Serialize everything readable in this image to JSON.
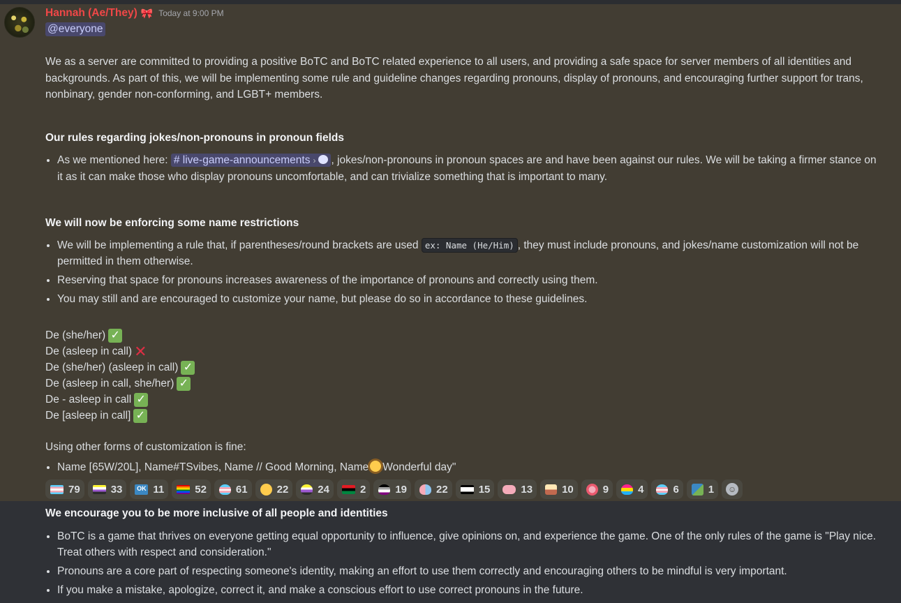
{
  "message": {
    "username": "Hannah (Ae/They)",
    "role_icon": "🎀",
    "timestamp": "Today at 9:00 PM",
    "mention": "@everyone",
    "intro": "We as a server are committed to providing a positive BoTC and BoTC related experience to all users, and providing a safe space for server members of all identities and backgrounds. As part of this, we will be implementing some rule and guideline changes regarding pronouns, display of pronouns, and encouraging further support for trans, nonbinary, gender non-conforming, and LGBT+ members.",
    "section1": {
      "heading": "Our rules regarding jokes/non-pronouns in pronoun fields",
      "bullet_prefix": "As we mentioned here:",
      "channel": "live-game-announcements",
      "bullet_suffix": ", jokes/non-pronouns in pronoun spaces are and have been against our rules. We will be taking a firmer stance on it as it can make those who display pronouns uncomfortable, and can trivialize something that is important to many."
    },
    "section2": {
      "heading": "We will now be enforcing some name restrictions",
      "b1_prefix": "We will be implementing a rule that, if parentheses/round brackets are used ",
      "b1_code": "ex: Name (He/Him)",
      "b1_suffix": ", they must include pronouns, and jokes/name customization will not be permitted in them otherwise.",
      "b2": "Reserving that space for pronouns increases awareness of the importance of pronouns and correctly using them.",
      "b3": "You may still and are encouraged to customize your name, but please do so in accordance to these guidelines."
    },
    "examples": [
      {
        "text": "De (she/her)",
        "ok": "✓"
      },
      {
        "text": "De (asleep in call)",
        "bad": "✕"
      },
      {
        "text": "De (she/her) (asleep in call)",
        "ok": "✓"
      },
      {
        "text": "De (asleep in call, she/her)",
        "ok": "✓"
      },
      {
        "text": "De - asleep in call",
        "ok": "✓"
      },
      {
        "text": "De [asleep in call]",
        "ok": "✓"
      }
    ],
    "customization": {
      "intro": "Using other forms of customization is fine:",
      "bullet_a": "Name [65W/20L], Name#TSvibes, Name // Good Morning, Name",
      "bullet_b": "Wonderful day\""
    },
    "reactions": [
      {
        "icon": "trans-flag-icon",
        "count": "79"
      },
      {
        "icon": "nonbinary-flag-icon",
        "count": "33"
      },
      {
        "icon": "ok-icon",
        "count": "11"
      },
      {
        "icon": "rainbow-flag-icon",
        "count": "52"
      },
      {
        "icon": "trans-heart-icon",
        "count": "61"
      },
      {
        "icon": "face-icon",
        "count": "22"
      },
      {
        "icon": "nonbinary-heart-icon",
        "count": "24"
      },
      {
        "icon": "pan-african-flag-icon",
        "count": "2"
      },
      {
        "icon": "ace-flag-icon",
        "count": "19"
      },
      {
        "icon": "genderfluid-heart-icon",
        "count": "22"
      },
      {
        "icon": "ace-stripe-flag-icon",
        "count": "15"
      },
      {
        "icon": "axolotl-icon",
        "count": "13"
      },
      {
        "icon": "cake-icon",
        "count": "10"
      },
      {
        "icon": "flower-icon",
        "count": "9"
      },
      {
        "icon": "pan-heart-icon",
        "count": "4"
      },
      {
        "icon": "trans-heart-2-icon",
        "count": "6"
      },
      {
        "icon": "person-icon",
        "count": "1"
      }
    ],
    "section3": {
      "heading": "We encourage you to be more inclusive of all people and identities",
      "b1": "BoTC is a game that thrives on everyone getting equal opportunity to influence, give opinions on, and experience the game. One of the only rules of the game is \"Play nice. Treat others with respect and consideration.\"",
      "b2": "Pronouns are a core part of respecting someone's identity, making an effort to use them correctly and encouraging others to be mindful is very important.",
      "b3": "If you make a mistake, apologize, correct it, and make a conscious effort to use correct pronouns in the future."
    }
  }
}
